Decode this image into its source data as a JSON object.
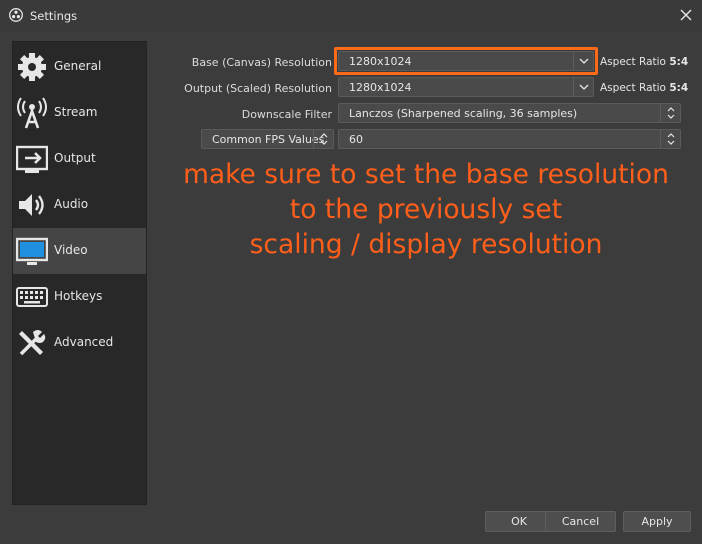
{
  "window": {
    "title": "Settings"
  },
  "sidebar": {
    "items": [
      {
        "label": "General",
        "icon": "gear-icon"
      },
      {
        "label": "Stream",
        "icon": "antenna-icon"
      },
      {
        "label": "Output",
        "icon": "output-icon"
      },
      {
        "label": "Audio",
        "icon": "speaker-icon"
      },
      {
        "label": "Video",
        "icon": "monitor-icon",
        "active": true
      },
      {
        "label": "Hotkeys",
        "icon": "keyboard-icon"
      },
      {
        "label": "Advanced",
        "icon": "tools-icon"
      }
    ]
  },
  "video": {
    "base_label": "Base (Canvas) Resolution",
    "base_value": "1280x1024",
    "base_aspect_prefix": "Aspect Ratio",
    "base_aspect_value": "5:4",
    "output_label": "Output (Scaled) Resolution",
    "output_value": "1280x1024",
    "output_aspect_prefix": "Aspect Ratio",
    "output_aspect_value": "5:4",
    "downscale_label": "Downscale Filter",
    "downscale_value": "Lanczos (Sharpened scaling, 36 samples)",
    "fps_type_value": "Common FPS Values",
    "fps_value": "60"
  },
  "annotation": {
    "line1": "make sure to set the base resolution",
    "line2": "to the previously set",
    "line3": "scaling / display resolution",
    "color": "#ff5f1a"
  },
  "buttons": {
    "ok": "OK",
    "cancel": "Cancel",
    "apply": "Apply"
  }
}
